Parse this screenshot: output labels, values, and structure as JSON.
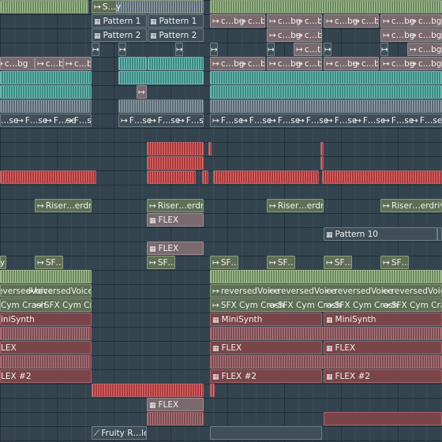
{
  "app": "FL Studio Playlist",
  "colors": {
    "background": "#34444f",
    "grid_line": "#1e2a32"
  },
  "clips": {
    "s_y": "S…y",
    "pattern1": "Pattern 1",
    "pattern2": "Pattern 2",
    "pattern10": "Pattern 10",
    "c_bg": "c…bg",
    "c_t": "c…t",
    "f_se": "F…se",
    "riser_erdrive": "Riser…erdrive",
    "flex": "FLEX",
    "flex2": "FLEX #2",
    "sf_y": "SF…y",
    "reversed_voice": "reversedVoice",
    "sfx_cym_crash": "SFX Cym Crash",
    "cym_crash_clipped": "Cym Crash",
    "minisynth": "MiniSynth",
    "minisynth_clipped": "iniSynth",
    "flex_clipped": "LEX",
    "flex2_clipped": "LEX #2",
    "fruity_level": "Fruity R…level",
    "y_clipped": "y"
  }
}
